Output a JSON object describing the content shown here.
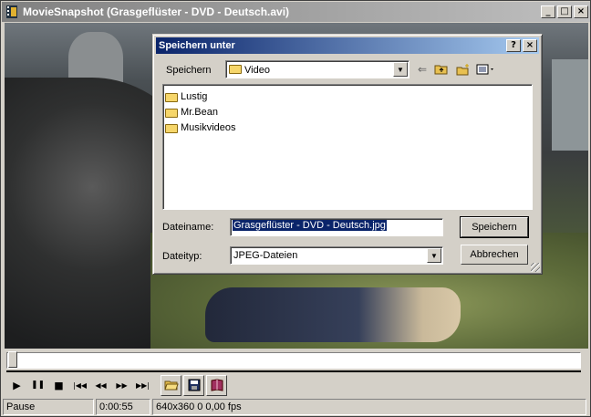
{
  "window": {
    "title": "MovieSnapshot (Grasgeflüster - DVD - Deutsch.avi)",
    "minimize": "_",
    "maximize": "□",
    "close": "×"
  },
  "dialog": {
    "title": "Speichern unter",
    "help": "?",
    "close": "×",
    "save_in_label": "Speichern",
    "save_in_value": "Video",
    "folders": [
      "Lustig",
      "Mr.Bean",
      "Musikvideos"
    ],
    "filename_label": "Dateiname:",
    "filename_value": "Grasgeflüster - DVD - Deutsch.jpg",
    "filetype_label": "Dateityp:",
    "filetype_value": "JPEG-Dateien",
    "save_button": "Speichern",
    "cancel_button": "Abbrechen"
  },
  "toolbar": {
    "play": "▶",
    "pause": "❚❚",
    "stop": "■",
    "prev": "|◀◀",
    "rewind": "◀◀",
    "forward": "▶▶",
    "next": "▶▶|",
    "open": "📂",
    "save": "💾",
    "about": "📖"
  },
  "status": {
    "state": "Pause",
    "time": "0:00:55",
    "info": "640x360 0 0,00 fps"
  },
  "icons": {
    "app": "film-icon",
    "folder": "folder-icon",
    "back": "back-arrow-icon",
    "up": "folder-up-icon",
    "new_folder": "new-folder-icon",
    "view": "view-menu-icon"
  },
  "colors": {
    "dialog_title_start": "#0a246a",
    "dialog_title_end": "#a6caf0",
    "selection": "#0a246a",
    "window_face": "#d4d0c8"
  }
}
